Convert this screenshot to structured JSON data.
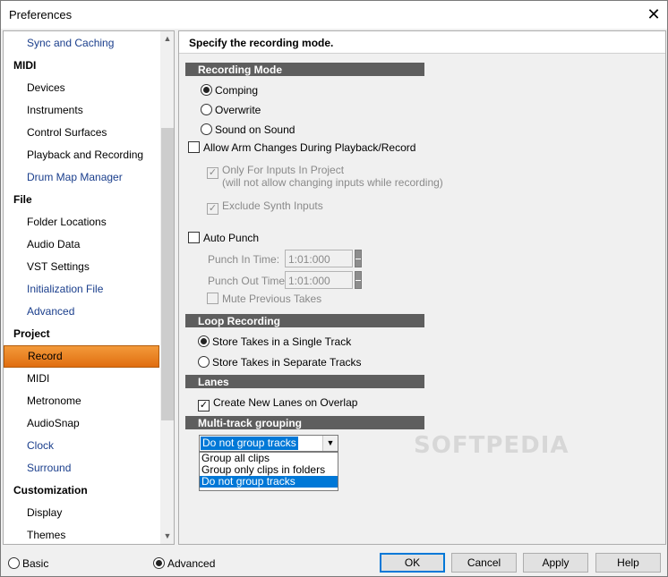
{
  "window": {
    "title": "Preferences",
    "close_label": "✕"
  },
  "tree": {
    "items": [
      {
        "label": "Sync and Caching",
        "kind": "sub",
        "link": true
      },
      {
        "label": "MIDI",
        "kind": "cat"
      },
      {
        "label": "Devices",
        "kind": "sub"
      },
      {
        "label": "Instruments",
        "kind": "sub"
      },
      {
        "label": "Control Surfaces",
        "kind": "sub"
      },
      {
        "label": "Playback and Recording",
        "kind": "sub"
      },
      {
        "label": "Drum Map Manager",
        "kind": "sub",
        "link": true
      },
      {
        "label": "File",
        "kind": "cat"
      },
      {
        "label": "Folder Locations",
        "kind": "sub"
      },
      {
        "label": "Audio Data",
        "kind": "sub"
      },
      {
        "label": "VST Settings",
        "kind": "sub"
      },
      {
        "label": "Initialization File",
        "kind": "sub",
        "link": true
      },
      {
        "label": "Advanced",
        "kind": "sub",
        "link": true
      },
      {
        "label": "Project",
        "kind": "cat"
      },
      {
        "label": "Record",
        "kind": "sub",
        "selected": true
      },
      {
        "label": "MIDI",
        "kind": "sub"
      },
      {
        "label": "Metronome",
        "kind": "sub"
      },
      {
        "label": "AudioSnap",
        "kind": "sub"
      },
      {
        "label": "Clock",
        "kind": "sub",
        "link": true
      },
      {
        "label": "Surround",
        "kind": "sub",
        "link": true
      },
      {
        "label": "Customization",
        "kind": "cat"
      },
      {
        "label": "Display",
        "kind": "sub"
      },
      {
        "label": "Themes",
        "kind": "sub"
      }
    ]
  },
  "panel": {
    "header": "Specify the recording mode.",
    "recording_mode": {
      "title": "Recording Mode",
      "comping": "Comping",
      "overwrite": "Overwrite",
      "sound_on_sound": "Sound on Sound",
      "allow_arm": "Allow Arm Changes During Playback/Record",
      "only_inputs_line1": "Only For Inputs In Project",
      "only_inputs_line2": "(will not allow changing inputs while recording)",
      "exclude_synth": "Exclude Synth Inputs",
      "auto_punch": "Auto Punch",
      "punch_in_label": "Punch In Time:",
      "punch_in_value": "1:01:000",
      "punch_out_label": "Punch Out Time:",
      "punch_out_value": "1:01:000",
      "mute_previous": "Mute Previous Takes"
    },
    "loop_recording": {
      "title": "Loop Recording",
      "single": "Store Takes in a Single Track",
      "separate": "Store Takes in Separate Tracks"
    },
    "lanes": {
      "title": "Lanes",
      "create_new": "Create New Lanes on Overlap"
    },
    "grouping": {
      "title": "Multi-track grouping",
      "selected": "Do not group tracks",
      "options": [
        "Group all clips",
        "Group only clips in folders",
        "Do not group tracks"
      ]
    },
    "watermark": "SOFTPEDIA"
  },
  "footer": {
    "basic": "Basic",
    "advanced": "Advanced",
    "ok": "OK",
    "cancel": "Cancel",
    "apply": "Apply",
    "help": "Help"
  }
}
